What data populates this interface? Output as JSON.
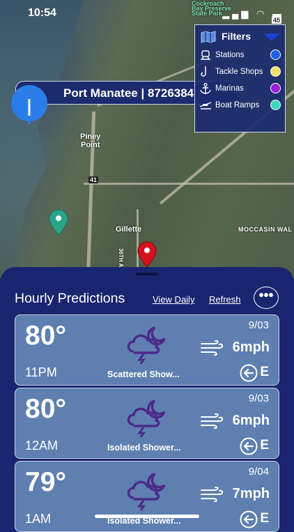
{
  "status_bar": {
    "time": "10:54",
    "icons": [
      "signal-icon",
      "wifi-icon",
      "battery-icon"
    ]
  },
  "map": {
    "station_banner": "Port Manatee | 8726384",
    "labels": [
      "Piney",
      "Point",
      "41",
      "Gillette",
      "MOCCASIN WAL",
      "36TH AV",
      "Cockroach",
      "Bay Preserve",
      "State Park",
      "45"
    ]
  },
  "filters": {
    "title": "Filters",
    "items": [
      {
        "label": "Stations",
        "color": "#1f5fe0",
        "icon": "station-icon"
      },
      {
        "label": "Tackle Shops",
        "color": "#f3e06a",
        "icon": "hook-icon"
      },
      {
        "label": "Marinas",
        "color": "#9b1fd6",
        "icon": "anchor-icon"
      },
      {
        "label": "Boat Ramps",
        "color": "#3fd8c2",
        "icon": "boat-ramp-icon"
      }
    ]
  },
  "panel": {
    "title": "Hourly Predictions",
    "view_daily": "View Daily",
    "refresh": "Refresh",
    "more": "•••"
  },
  "forecast": [
    {
      "temp": "80°",
      "date": "9/03",
      "speed": "6mph",
      "hour": "11PM",
      "desc": "Scattered Show...",
      "dir": "E"
    },
    {
      "temp": "80°",
      "date": "9/03",
      "speed": "6mph",
      "hour": "12AM",
      "desc": "Isolated Shower...",
      "dir": "E"
    },
    {
      "temp": "79°",
      "date": "9/04",
      "speed": "7mph",
      "hour": "1AM",
      "desc": "Isolated Shower...",
      "dir": "E"
    }
  ],
  "colors": {
    "panel": "#1a2570",
    "card": "#5e7fb0",
    "weather_icon": "#4b2a8a"
  }
}
